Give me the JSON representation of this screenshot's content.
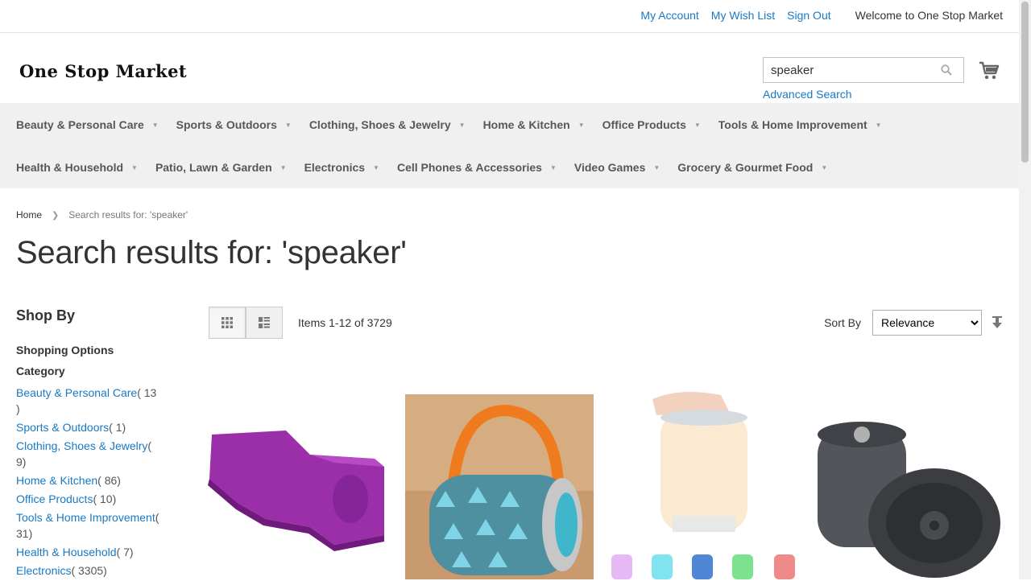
{
  "top_links": {
    "my_account": "My Account",
    "my_wish_list": "My Wish List",
    "sign_out": "Sign Out",
    "welcome": "Welcome to One Stop Market"
  },
  "logo": {
    "text": "One Stop Market"
  },
  "search": {
    "value": "speaker",
    "advanced": "Advanced Search"
  },
  "nav": {
    "row1": [
      "Beauty & Personal Care",
      "Sports & Outdoors",
      "Clothing, Shoes & Jewelry",
      "Home & Kitchen",
      "Office Products",
      "Tools & Home Improvement"
    ],
    "row2": [
      "Health & Household",
      "Patio, Lawn & Garden",
      "Electronics",
      "Cell Phones & Accessories",
      "Video Games",
      "Grocery & Gourmet Food"
    ]
  },
  "breadcrumb": {
    "home": "Home",
    "current": "Search results for: 'speaker'"
  },
  "page_title": "Search results for: 'speaker'",
  "sidebar": {
    "shop_by": "Shop By",
    "shopping_options": "Shopping Options",
    "category_title": "Category",
    "categories": [
      {
        "name": "Beauty & Personal Care",
        "count": "( 13 )"
      },
      {
        "name": "Sports & Outdoors",
        "count": "( 1)"
      },
      {
        "name": "Clothing, Shoes & Jewelry",
        "count": "( 9)"
      },
      {
        "name": "Home & Kitchen",
        "count": "( 86)"
      },
      {
        "name": "Office Products",
        "count": "( 10)"
      },
      {
        "name": "Tools & Home Improvement",
        "count": "( 31)"
      },
      {
        "name": "Health & Household",
        "count": "( 7)"
      },
      {
        "name": "Electronics",
        "count": "( 3305)"
      }
    ]
  },
  "toolbar": {
    "items_count": "Items 1-12 of 3729",
    "sort_by": "Sort By",
    "sort_selected": "Relevance"
  },
  "colors": {
    "link": "#1979c3",
    "nav_bg": "#f0f0f0"
  }
}
